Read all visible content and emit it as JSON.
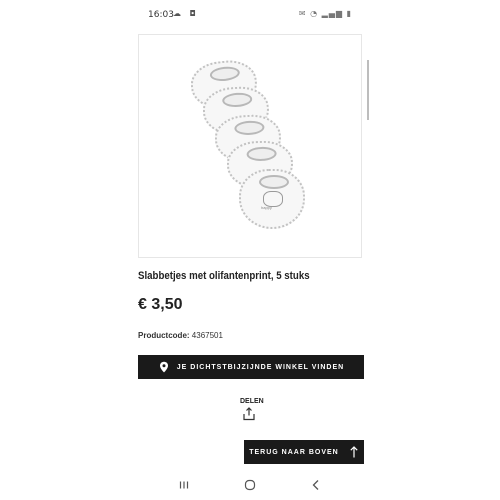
{
  "status_bar": {
    "time": "16:03",
    "left_icons": "☁ ◘",
    "right_icons": "✉ ◔ ▂▄▆ ▮"
  },
  "product": {
    "image_alt": "Baby bibs with elephant print",
    "bib_text": "happy",
    "title": "Slabbetjes met olifantenprint, 5 stuks",
    "price": "€ 3,50",
    "code_label": "Productcode:",
    "code_value": "4367501"
  },
  "actions": {
    "store_finder_label": "JE DICHTSTBIJZIJNDE WINKEL VINDEN",
    "share_label": "DELEN",
    "back_to_top_label": "TERUG NAAR BOVEN"
  },
  "icons": {
    "pin": "location-pin-icon",
    "share": "share-icon",
    "arrow_up": "arrow-up-icon",
    "nav_recent": "recent-apps-icon",
    "nav_home": "home-icon",
    "nav_back": "back-icon"
  },
  "colors": {
    "button_bg": "#1a1a1a",
    "button_text": "#ffffff",
    "text": "#222222"
  }
}
